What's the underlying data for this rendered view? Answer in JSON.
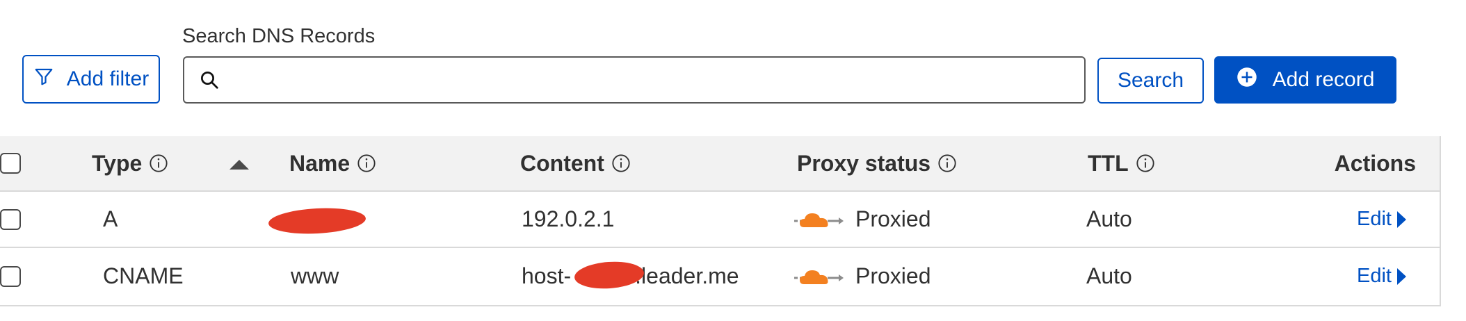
{
  "toolbar": {
    "search_label": "Search DNS Records",
    "add_filter_label": "Add filter",
    "search_value": "",
    "search_button_label": "Search",
    "add_record_label": "Add record"
  },
  "table": {
    "columns": {
      "type": "Type",
      "name": "Name",
      "content": "Content",
      "proxy_status": "Proxy status",
      "ttl": "TTL",
      "actions": "Actions"
    },
    "rows": [
      {
        "type": "A",
        "name": "",
        "content": "192.0.2.1",
        "proxy_status": "Proxied",
        "ttl": "Auto",
        "action": "Edit"
      },
      {
        "type": "CNAME",
        "name": "www",
        "content_prefix": "host-",
        "content_suffix": ".leader.me",
        "proxy_status": "Proxied",
        "ttl": "Auto",
        "action": "Edit"
      }
    ]
  },
  "colors": {
    "accent": "#0051c3",
    "proxy_cloud": "#f38020",
    "redaction": "#e43b27",
    "header_bg": "#f2f2f2"
  },
  "icons": {
    "filter": "filter-icon",
    "search": "search-icon",
    "add": "plus-circle-icon",
    "info": "info-icon",
    "sort": "sort-ascending-icon",
    "proxy": "cloud-proxied-icon",
    "edit_caret": "caret-right-icon"
  }
}
